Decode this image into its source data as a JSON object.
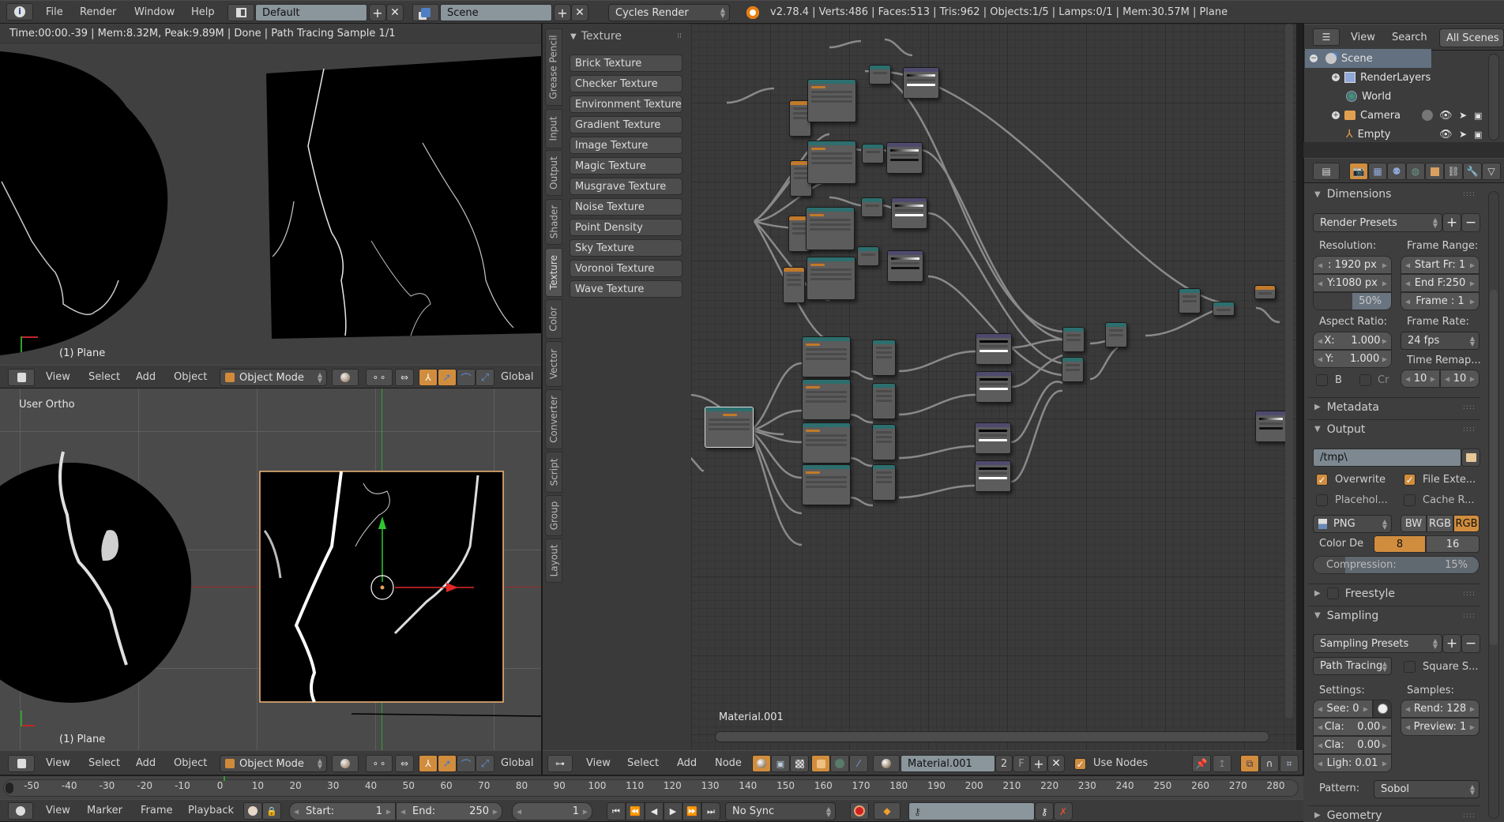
{
  "topbar": {
    "menus": [
      "File",
      "Render",
      "Window",
      "Help"
    ],
    "layout": "Default",
    "scene": "Scene",
    "engine": "Cycles Render",
    "stats": "v2.78.4 | Verts:486 | Faces:513 | Tris:962 | Objects:1/5 | Lamps:0/1 | Mem:30.57M | Plane"
  },
  "image_editor": {
    "render_info": "Time:00:00.-39 | Mem:8.32M, Peak:9.89M | Done | Path Tracing Sample 1/1",
    "object_label": "(1) Plane"
  },
  "viewport_header": {
    "menus": [
      "View",
      "Select",
      "Add",
      "Object"
    ],
    "mode": "Object Mode",
    "orientation": "Global"
  },
  "viewport_3d": {
    "view_label": "User Ortho",
    "object_label": "(1) Plane"
  },
  "node_editor": {
    "vertical_tabs": [
      "Grease Pencil",
      "Input",
      "Output",
      "Shader",
      "Texture",
      "Color",
      "Vector",
      "Converter",
      "Script",
      "Group",
      "Layout"
    ],
    "active_tab": "Texture",
    "panel_title": "Texture",
    "tool_buttons": [
      "Brick Texture",
      "Checker Texture",
      "Environment Texture",
      "Gradient Texture",
      "Image Texture",
      "Magic Texture",
      "Musgrave Texture",
      "Noise Texture",
      "Point Density",
      "Sky Texture",
      "Voronoi Texture",
      "Wave Texture"
    ],
    "material_label": "Material.001",
    "header": {
      "menus": [
        "View",
        "Select",
        "Add",
        "Node"
      ],
      "material": "Material.001",
      "users": "2",
      "fake_user": "F",
      "use_nodes_label": "Use Nodes",
      "use_nodes": true
    }
  },
  "outliner": {
    "menus": [
      "View",
      "Search"
    ],
    "filter": "All Scenes",
    "items": [
      {
        "label": "Scene",
        "icon": "scene-icon",
        "level": 0
      },
      {
        "label": "RenderLayers",
        "icon": "renderlayers-icon",
        "level": 1
      },
      {
        "label": "World",
        "icon": "world-icon",
        "level": 1
      },
      {
        "label": "Camera",
        "icon": "camera-icon",
        "level": 1
      },
      {
        "label": "Empty",
        "icon": "empty-icon",
        "level": 1
      }
    ]
  },
  "properties": {
    "dimensions": {
      "title": "Dimensions",
      "presets": "Render Presets",
      "resolution_label": "Resolution:",
      "res_x": ": 1920 px",
      "res_y": "Y:1080 px",
      "res_pct": "50%",
      "res_pct_value": 0.5,
      "frame_range_label": "Frame Range:",
      "start": "Start Fr: 1",
      "end": "End F:250",
      "frame": "Frame : 1",
      "aspect_label": "Aspect Ratio:",
      "aspect_x": "X:     1.000",
      "aspect_y": "Y:     1.000",
      "frame_rate_label": "Frame Rate:",
      "fps": "24 fps",
      "time_remap_label": "Time Remap...",
      "remap_old": "10",
      "remap_new": "10",
      "border_label": "B",
      "crop_label": "Cr"
    },
    "metadata": {
      "title": "Metadata"
    },
    "output": {
      "title": "Output",
      "path": "/tmp\\",
      "overwrite": "Overwrite",
      "file_ext": "File Exte...",
      "placeholders": "Placehol...",
      "cache": "Cache R...",
      "format": "PNG",
      "color_modes": [
        "BW",
        "RGB",
        "RGB"
      ],
      "color_mode_active": 2,
      "color_depth_label": "Color De",
      "color_depths": [
        "8",
        "16"
      ],
      "color_depth_active": 0,
      "compression": "Compression:",
      "compression_value": "15%"
    },
    "freestyle": {
      "title": "Freestyle"
    },
    "sampling": {
      "title": "Sampling",
      "presets": "Sampling Presets",
      "integrator": "Path Tracing",
      "square_samples": "Square S...",
      "settings_label": "Settings:",
      "samples_label": "Samples:",
      "seed": "See: 0",
      "clamp_direct": "Cla:    0.00",
      "clamp_indirect": "Cla:    0.00",
      "light_threshold": "Ligh: 0.01",
      "render": "Rend: 128",
      "preview": "Preview: 1",
      "pattern_label": "Pattern:",
      "pattern": "Sobol"
    },
    "geometry": {
      "title": "Geometry"
    }
  },
  "timeline": {
    "ticks": [
      -50,
      -40,
      -30,
      -20,
      -10,
      0,
      10,
      20,
      30,
      40,
      50,
      60,
      70,
      80,
      90,
      100,
      110,
      120,
      130,
      140,
      150,
      160,
      170,
      180,
      190,
      200,
      210,
      220,
      230,
      240,
      250,
      260,
      270,
      280
    ],
    "current_frame": 1,
    "menus": [
      "View",
      "Marker",
      "Frame",
      "Playback"
    ],
    "start_label": "Start:",
    "start": "1",
    "end_label": "End:",
    "end": "250",
    "frame": "1",
    "sync": "No Sync"
  },
  "colors": {
    "accent": "#d18d3e",
    "header": "#3b3b3b",
    "panel": "#464646",
    "node_canvas": "#3a3a3a"
  }
}
